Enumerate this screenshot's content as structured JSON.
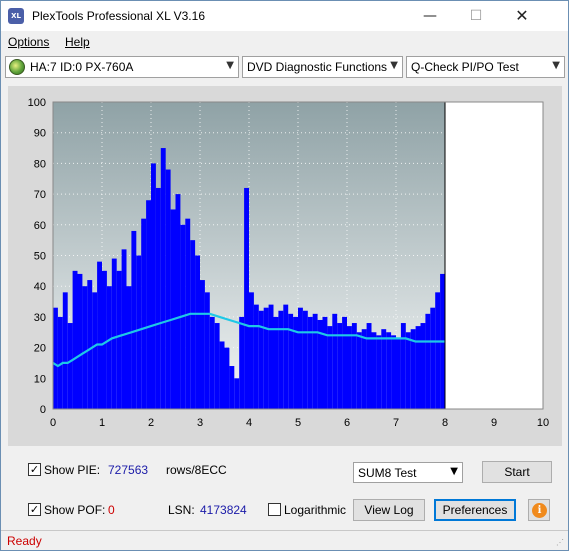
{
  "window": {
    "title": "PlexTools Professional XL V3.16",
    "icon_text": "XL",
    "minimize_glyph": "—",
    "maximize_glyph": "☐",
    "close_glyph": "✕"
  },
  "menu": {
    "options": "Options",
    "help": "Help"
  },
  "toolbar": {
    "drive": "HA:7 ID:0  PX-760A",
    "function": "DVD Diagnostic Functions",
    "test": "Q-Check PI/PO Test"
  },
  "controls": {
    "show_pie_label": "Show PIE:",
    "pie_value": "727563",
    "rows_label": "rows/8ECC",
    "show_pof_label": "Show POF:",
    "pof_value": "0",
    "lsn_label": "LSN:",
    "lsn_value": "4173824",
    "logarithmic_label": "Logarithmic",
    "sum_select": "SUM8 Test",
    "start_button": "Start",
    "view_log_button": "View Log",
    "preferences_button": "Preferences",
    "info_glyph": "i",
    "show_pie_checked": true,
    "show_pof_checked": true,
    "logarithmic_checked": false
  },
  "status": {
    "text": "Ready"
  },
  "chart_data": {
    "type": "bar",
    "xlim": [
      0,
      10
    ],
    "ylim": [
      0,
      100
    ],
    "x_ticks": [
      "0",
      "1",
      "2",
      "3",
      "4",
      "5",
      "6",
      "7",
      "8",
      "9",
      "10"
    ],
    "y_ticks": [
      "0",
      "10",
      "20",
      "30",
      "40",
      "50",
      "60",
      "70",
      "80",
      "90",
      "100"
    ],
    "end_marker_x": 8,
    "grid": true,
    "bar_color": "#0000ff",
    "line_color": "#1ec8e6",
    "series": [
      {
        "kind": "bars",
        "x": [
          0.0,
          0.1,
          0.2,
          0.3,
          0.4,
          0.5,
          0.6,
          0.7,
          0.8,
          0.9,
          1.0,
          1.1,
          1.2,
          1.3,
          1.4,
          1.5,
          1.6,
          1.7,
          1.8,
          1.9,
          2.0,
          2.1,
          2.2,
          2.3,
          2.4,
          2.5,
          2.6,
          2.7,
          2.8,
          2.9,
          3.0,
          3.1,
          3.2,
          3.3,
          3.4,
          3.5,
          3.6,
          3.7,
          3.8,
          3.9,
          4.0,
          4.1,
          4.2,
          4.3,
          4.4,
          4.5,
          4.6,
          4.7,
          4.8,
          4.9,
          5.0,
          5.1,
          5.2,
          5.3,
          5.4,
          5.5,
          5.6,
          5.7,
          5.8,
          5.9,
          6.0,
          6.1,
          6.2,
          6.3,
          6.4,
          6.5,
          6.6,
          6.7,
          6.8,
          6.9,
          7.0,
          7.1,
          7.2,
          7.3,
          7.4,
          7.5,
          7.6,
          7.7,
          7.8,
          7.9
        ],
        "values": [
          33,
          30,
          38,
          28,
          45,
          44,
          40,
          42,
          38,
          48,
          45,
          40,
          49,
          45,
          52,
          40,
          58,
          50,
          62,
          68,
          80,
          72,
          85,
          78,
          65,
          70,
          60,
          62,
          55,
          50,
          42,
          38,
          30,
          28,
          22,
          20,
          14,
          10,
          30,
          72,
          38,
          34,
          32,
          33,
          34,
          30,
          32,
          34,
          31,
          30,
          33,
          32,
          30,
          31,
          29,
          30,
          27,
          31,
          28,
          30,
          27,
          28,
          25,
          26,
          28,
          25,
          24,
          26,
          25,
          24,
          23,
          28,
          25,
          26,
          27,
          28,
          31,
          33,
          38,
          44
        ]
      },
      {
        "kind": "line",
        "name": "",
        "x": [
          0.0,
          0.1,
          0.2,
          0.3,
          0.4,
          0.5,
          0.6,
          0.7,
          0.8,
          0.9,
          1.0,
          1.2,
          1.4,
          1.6,
          1.8,
          2.0,
          2.2,
          2.4,
          2.6,
          2.8,
          3.0,
          3.2,
          3.4,
          3.6,
          3.8,
          4.0,
          4.2,
          4.4,
          4.6,
          4.8,
          5.0,
          5.2,
          5.4,
          5.6,
          5.8,
          6.0,
          6.2,
          6.4,
          6.6,
          6.8,
          7.0,
          7.2,
          7.4,
          7.6,
          7.8,
          8.0
        ],
        "values": [
          15,
          14,
          15,
          15,
          16,
          17,
          18,
          19,
          20,
          21,
          21,
          23,
          24,
          25,
          26,
          27,
          28,
          29,
          30,
          31,
          31,
          31,
          30,
          29,
          28,
          27,
          27,
          26,
          26,
          26,
          25,
          25,
          25,
          24,
          24,
          24,
          24,
          23,
          23,
          23,
          23,
          23,
          22,
          22,
          22,
          22
        ]
      }
    ]
  }
}
